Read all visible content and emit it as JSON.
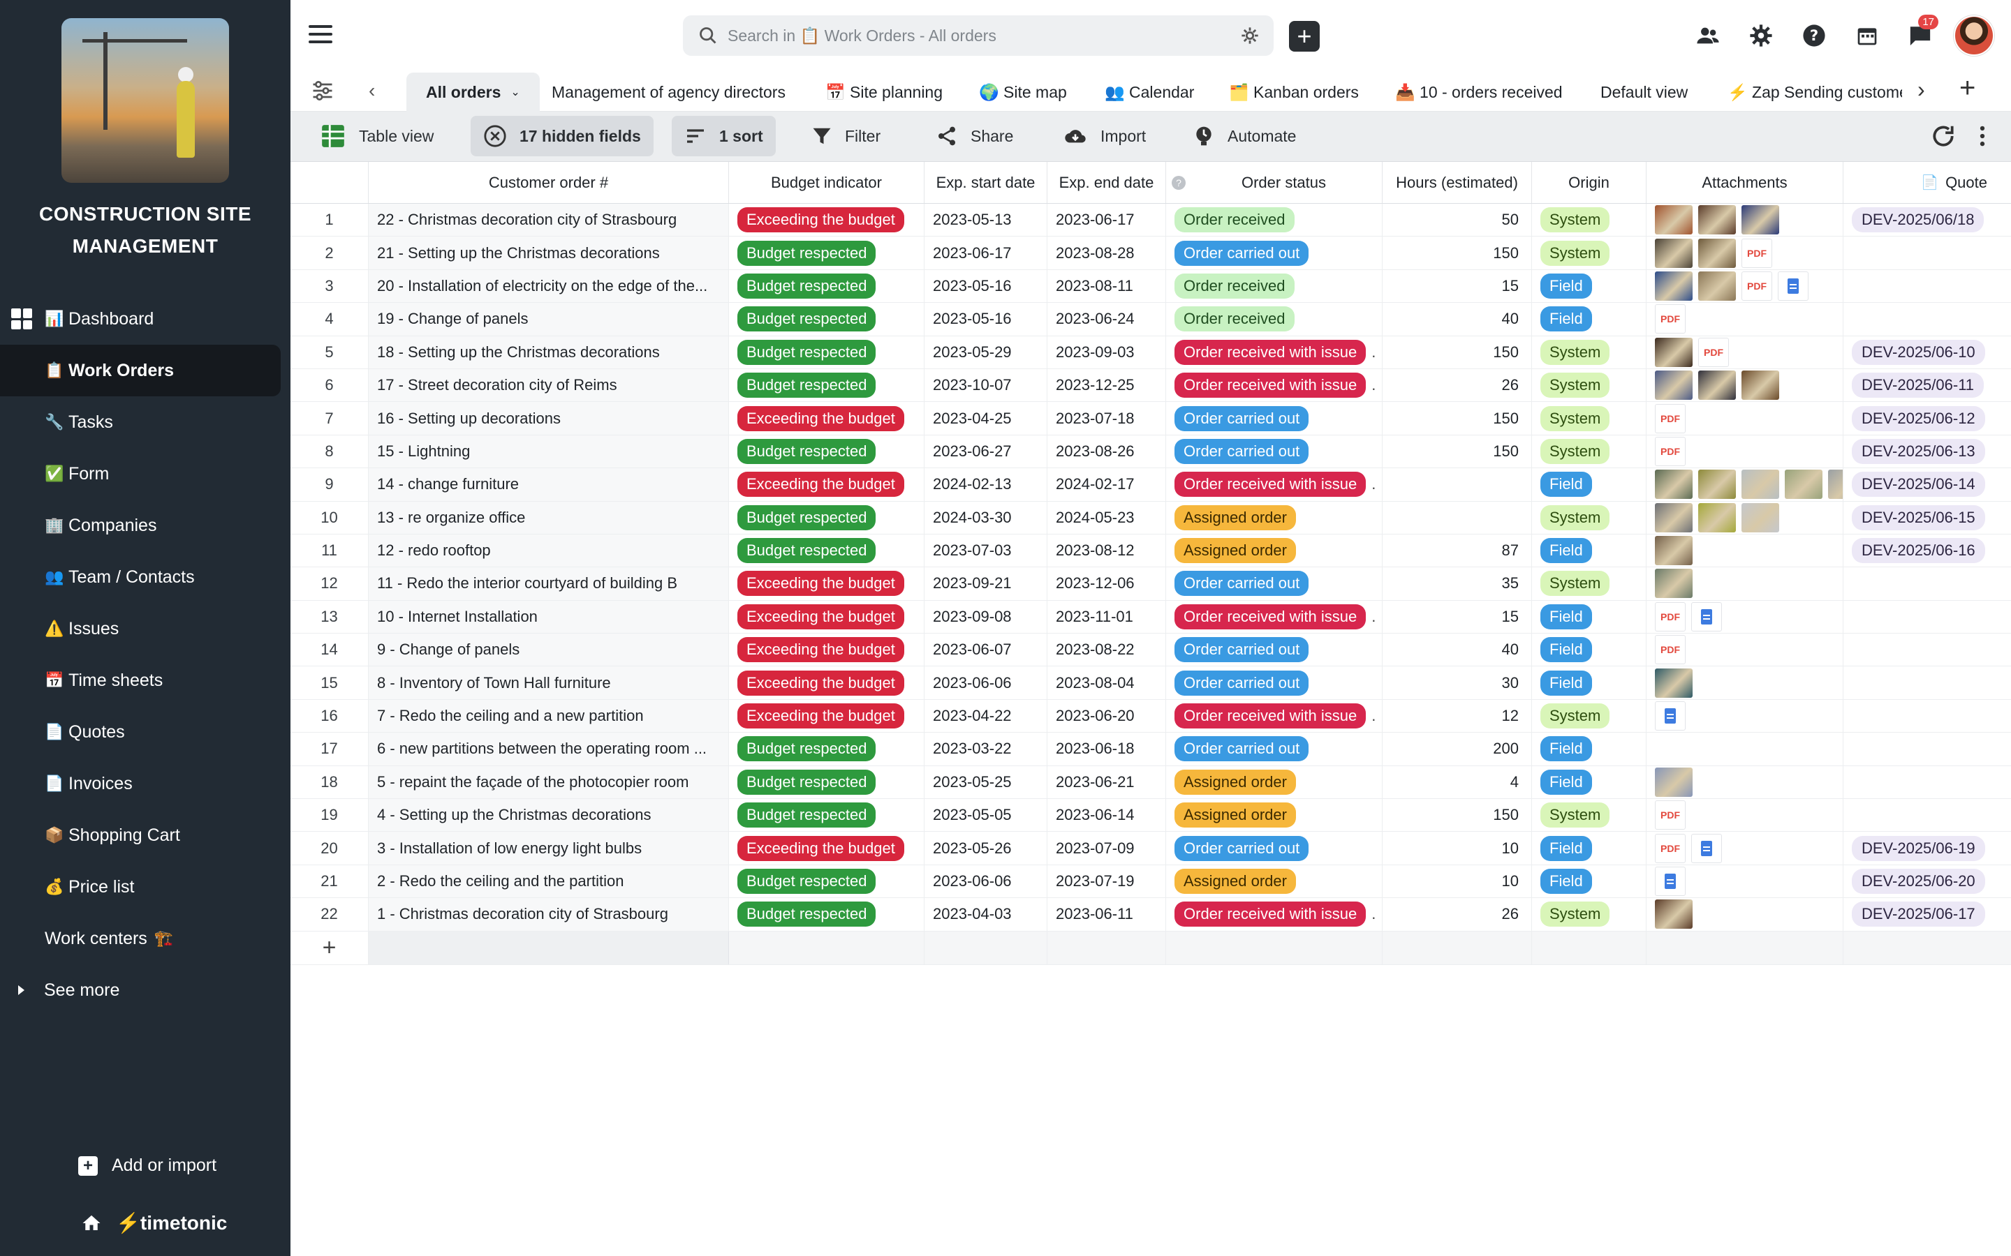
{
  "sidebar": {
    "app_title": "CONSTRUCTION SITE MANAGEMENT",
    "items": [
      {
        "icon": "📊",
        "label": "Dashboard"
      },
      {
        "icon": "📋",
        "label": "Work Orders"
      },
      {
        "icon": "🔧",
        "label": "Tasks"
      },
      {
        "icon": "✅",
        "label": "Form"
      },
      {
        "icon": "🏢",
        "label": "Companies"
      },
      {
        "icon": "👥",
        "label": "Team / Contacts"
      },
      {
        "icon": "⚠️",
        "label": "Issues"
      },
      {
        "icon": "📅",
        "label": "Time sheets"
      },
      {
        "icon": "📄",
        "label": "Quotes"
      },
      {
        "icon": "📄",
        "label": "Invoices"
      },
      {
        "icon": "📦",
        "label": "Shopping Cart"
      },
      {
        "icon": "💰",
        "label": "Price list"
      },
      {
        "icon": "🏗️",
        "label": "Work centers"
      },
      {
        "icon": "",
        "label": "See more"
      }
    ],
    "add_import": "Add or import",
    "brand": "timetonic"
  },
  "topbar": {
    "search_placeholder": "Search in 📋 Work Orders - All orders",
    "notification_count": "17"
  },
  "views": {
    "tabs": [
      {
        "label": "All orders"
      },
      {
        "label": "Management of agency directors"
      },
      {
        "label": "📅 Site planning"
      },
      {
        "label": "🌍 Site map"
      },
      {
        "label": "👥 Calendar"
      },
      {
        "label": "🗂️ Kanban orders"
      },
      {
        "label": "📥 10 - orders received"
      },
      {
        "label": "Default view"
      },
      {
        "label": "⚡ Zap Sending custome"
      }
    ]
  },
  "toolbar": {
    "table_view": "Table view",
    "hidden_fields": "17 hidden fields",
    "sort": "1 sort",
    "filter": "Filter",
    "share": "Share",
    "import": "Import",
    "automate": "Automate"
  },
  "table": {
    "columns": {
      "name": "Customer order #",
      "budget": "Budget indicator",
      "start": "Exp. start date",
      "end": "Exp. end date",
      "status": "Order status",
      "hours": "Hours (estimated)",
      "origin": "Origin",
      "attachments": "Attachments",
      "quote": "Quote"
    },
    "rows": [
      {
        "n": "1",
        "name": "22 - Christmas decoration city of Strasbourg",
        "budget": "Exceeding the budget",
        "start": "2023-05-13",
        "end": "2023-06-17",
        "status": "Order received",
        "hours": "50",
        "origin": "System",
        "quote": "DEV-2025/06/18"
      },
      {
        "n": "2",
        "name": "21 - Setting up the Christmas decorations",
        "budget": "Budget respected",
        "start": "2023-06-17",
        "end": "2023-08-28",
        "status": "Order carried out",
        "hours": "150",
        "origin": "System",
        "quote": ""
      },
      {
        "n": "3",
        "name": "20 - Installation of electricity on the edge of the...",
        "budget": "Budget respected",
        "start": "2023-05-16",
        "end": "2023-08-11",
        "status": "Order received",
        "hours": "15",
        "origin": "Field",
        "quote": ""
      },
      {
        "n": "4",
        "name": "19 - Change of panels",
        "budget": "Budget respected",
        "start": "2023-05-16",
        "end": "2023-06-24",
        "status": "Order received",
        "hours": "40",
        "origin": "Field",
        "quote": ""
      },
      {
        "n": "5",
        "name": "18 - Setting up the Christmas decorations",
        "budget": "Budget respected",
        "start": "2023-05-29",
        "end": "2023-09-03",
        "status": "Order received with issue",
        "hours": "150",
        "origin": "System",
        "quote": "DEV-2025/06-10"
      },
      {
        "n": "6",
        "name": "17 - Street decoration city of Reims",
        "budget": "Budget respected",
        "start": "2023-10-07",
        "end": "2023-12-25",
        "status": "Order received with issue",
        "hours": "26",
        "origin": "System",
        "quote": "DEV-2025/06-11"
      },
      {
        "n": "7",
        "name": "16 - Setting up decorations",
        "budget": "Exceeding the budget",
        "start": "2023-04-25",
        "end": "2023-07-18",
        "status": "Order carried out",
        "hours": "150",
        "origin": "System",
        "quote": "DEV-2025/06-12"
      },
      {
        "n": "8",
        "name": "15 - Lightning",
        "budget": "Budget respected",
        "start": "2023-06-27",
        "end": "2023-08-26",
        "status": "Order carried out",
        "hours": "150",
        "origin": "System",
        "quote": "DEV-2025/06-13"
      },
      {
        "n": "9",
        "name": "14 - change furniture",
        "budget": "Exceeding the budget",
        "start": "2024-02-13",
        "end": "2024-02-17",
        "status": "Order received with issue",
        "hours": "",
        "origin": "Field",
        "quote": "DEV-2025/06-14"
      },
      {
        "n": "10",
        "name": "13 - re organize office",
        "budget": "Budget respected",
        "start": "2024-03-30",
        "end": "2024-05-23",
        "status": "Assigned order",
        "hours": "",
        "origin": "System",
        "quote": "DEV-2025/06-15"
      },
      {
        "n": "11",
        "name": "12 - redo rooftop",
        "budget": "Budget respected",
        "start": "2023-07-03",
        "end": "2023-08-12",
        "status": "Assigned order",
        "hours": "87",
        "origin": "Field",
        "quote": "DEV-2025/06-16"
      },
      {
        "n": "12",
        "name": "11 - Redo the interior courtyard of building B",
        "budget": "Exceeding the budget",
        "start": "2023-09-21",
        "end": "2023-12-06",
        "status": "Order carried out",
        "hours": "35",
        "origin": "System",
        "quote": ""
      },
      {
        "n": "13",
        "name": "10 - Internet Installation",
        "budget": "Exceeding the budget",
        "start": "2023-09-08",
        "end": "2023-11-01",
        "status": "Order received with issue",
        "hours": "15",
        "origin": "Field",
        "quote": ""
      },
      {
        "n": "14",
        "name": "9 - Change of panels",
        "budget": "Exceeding the budget",
        "start": "2023-06-07",
        "end": "2023-08-22",
        "status": "Order carried out",
        "hours": "40",
        "origin": "Field",
        "quote": ""
      },
      {
        "n": "15",
        "name": "8 - Inventory of Town Hall furniture",
        "budget": "Exceeding the budget",
        "start": "2023-06-06",
        "end": "2023-08-04",
        "status": "Order carried out",
        "hours": "30",
        "origin": "Field",
        "quote": ""
      },
      {
        "n": "16",
        "name": "7 - Redo the ceiling and a new partition",
        "budget": "Exceeding the budget",
        "start": "2023-04-22",
        "end": "2023-06-20",
        "status": "Order received with issue",
        "hours": "12",
        "origin": "System",
        "quote": ""
      },
      {
        "n": "17",
        "name": "6 - new partitions between the operating room ...",
        "budget": "Budget respected",
        "start": "2023-03-22",
        "end": "2023-06-18",
        "status": "Order carried out",
        "hours": "200",
        "origin": "Field",
        "quote": ""
      },
      {
        "n": "18",
        "name": "5 - repaint the façade of the photocopier room",
        "budget": "Budget respected",
        "start": "2023-05-25",
        "end": "2023-06-21",
        "status": "Assigned order",
        "hours": "4",
        "origin": "Field",
        "quote": ""
      },
      {
        "n": "19",
        "name": "4 - Setting up the Christmas decorations",
        "budget": "Budget respected",
        "start": "2023-05-05",
        "end": "2023-06-14",
        "status": "Assigned order",
        "hours": "150",
        "origin": "System",
        "quote": ""
      },
      {
        "n": "20",
        "name": "3 - Installation of low energy light bulbs",
        "budget": "Exceeding the budget",
        "start": "2023-05-26",
        "end": "2023-07-09",
        "status": "Order carried out",
        "hours": "10",
        "origin": "Field",
        "quote": "DEV-2025/06-19"
      },
      {
        "n": "21",
        "name": "2 - Redo the ceiling and the partition",
        "budget": "Budget respected",
        "start": "2023-06-06",
        "end": "2023-07-19",
        "status": "Assigned order",
        "hours": "10",
        "origin": "Field",
        "quote": "DEV-2025/06-20"
      },
      {
        "n": "22",
        "name": "1 - Christmas decoration city of Strasbourg",
        "budget": "Budget respected",
        "start": "2023-04-03",
        "end": "2023-06-11",
        "status": "Order received with issue",
        "hours": "26",
        "origin": "System",
        "quote": "DEV-2025/06-17"
      }
    ],
    "attachments": [
      [
        "img:#a0522d",
        "img:#5a3b2a",
        "img:#2b3a78"
      ],
      [
        "img:#4a4236",
        "img:#6e5a3c",
        "pdf"
      ],
      [
        "img:#2c4c8a",
        "img:#8a7656",
        "pdf",
        "doc"
      ],
      [
        "pdf"
      ],
      [
        "img:#3b2a1e",
        "pdf"
      ],
      [
        "img:#4b5a86",
        "img:#2f2f3a",
        "img:#6a4a2a"
      ],
      [
        "pdf"
      ],
      [
        "pdf"
      ],
      [
        "img:#5a6a52",
        "img:#8d8a3a",
        "img:#b8bfc2",
        "img:#97a27a",
        "img:#9aa0a4"
      ],
      [
        "img:#6c6f74",
        "img:#a4a83a",
        "img:#c5c8cc"
      ],
      [
        "img:#74604a"
      ],
      [
        "img:#6a7a68"
      ],
      [
        "pdf",
        "doc"
      ],
      [
        "pdf"
      ],
      [
        "img:#2e5a66"
      ],
      [
        "doc"
      ],
      [],
      [
        "img:#8796b8"
      ],
      [
        "pdf"
      ],
      [
        "pdf",
        "doc"
      ],
      [
        "doc"
      ],
      [
        "img:#5a3b28"
      ]
    ],
    "attachment_pdf_label": "PDF"
  },
  "colors": {
    "sidebar_bg": "#222b34",
    "exceed": "#d7263d",
    "ok": "#2e9a3e",
    "carried": "#3a9ae2",
    "assigned": "#f6b73c"
  }
}
